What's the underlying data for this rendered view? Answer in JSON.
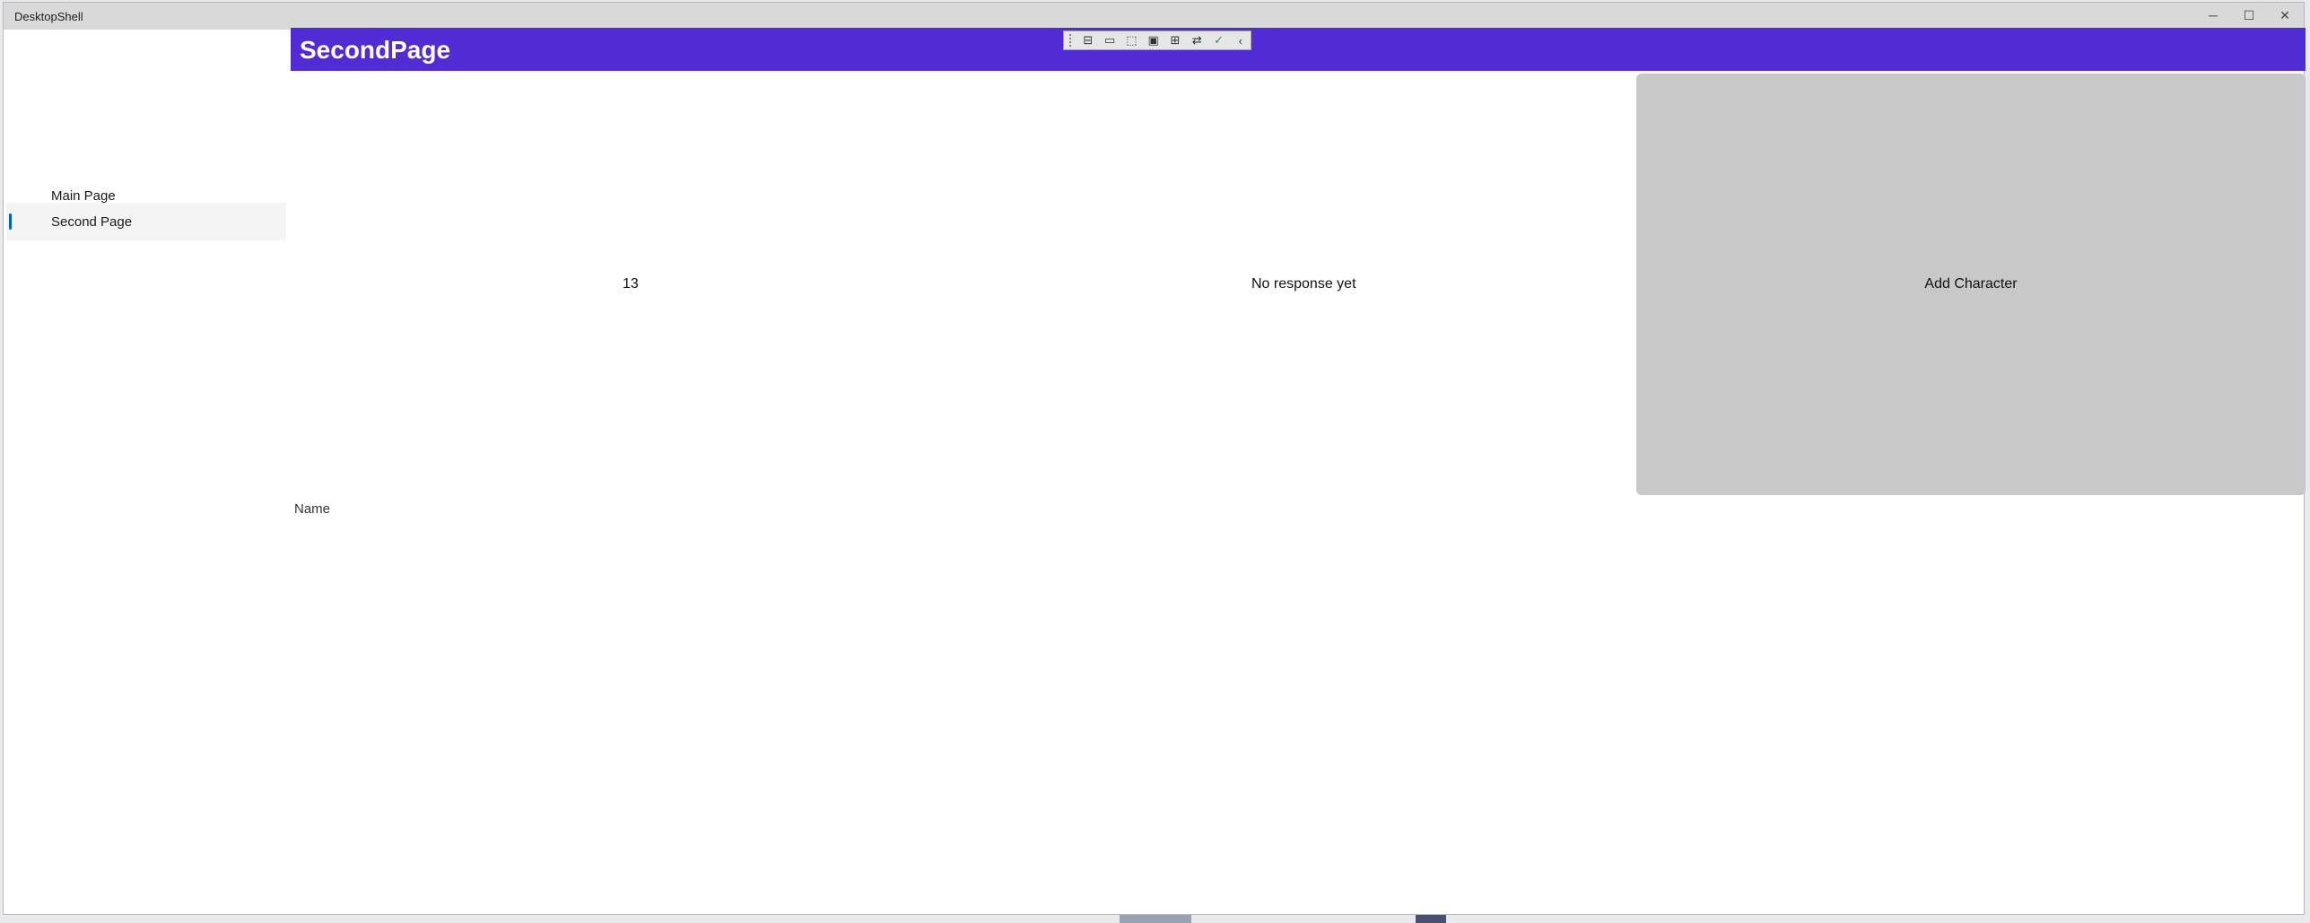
{
  "window": {
    "title": "DesktopShell",
    "controls": {
      "minimize": "─",
      "maximize": "☐",
      "close": "✕"
    }
  },
  "sidebar": {
    "items": [
      {
        "label": "Main Page",
        "selected": false
      },
      {
        "label": "Second Page",
        "selected": true
      }
    ]
  },
  "header": {
    "title": "SecondPage",
    "color": "#512bd4"
  },
  "debug_toolbar": {
    "icons": [
      "live-visual-tree-icon",
      "record-icon",
      "select-element-icon",
      "display-layout-adorners-icon",
      "track-focus-icon",
      "binding-failures-icon",
      "accessibility-check-icon",
      "collapse-toolbar-icon"
    ],
    "glyphs": [
      "⊟",
      "▭",
      "⬚",
      "▣",
      "⊞",
      "⇄",
      "✓",
      "‹"
    ]
  },
  "content": {
    "counter_value": "13",
    "response_text": "No response yet",
    "add_button_label": "Add Character",
    "name_label": "Name"
  }
}
